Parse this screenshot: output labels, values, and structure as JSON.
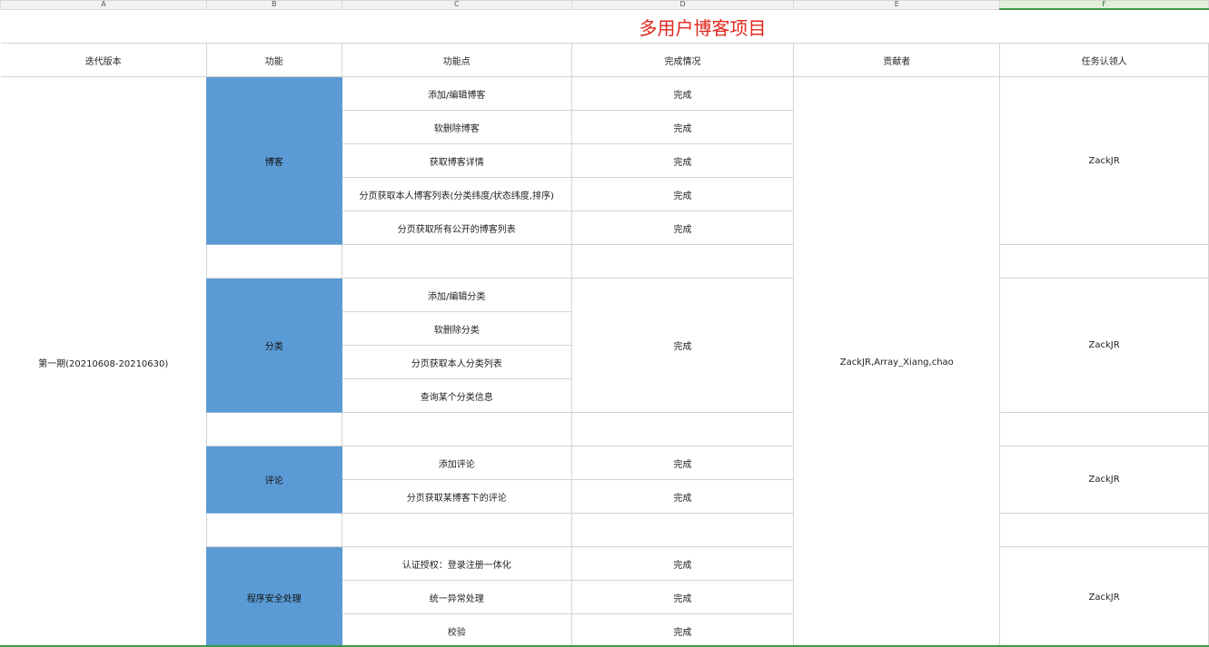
{
  "col_headers": [
    "A",
    "B",
    "C",
    "D",
    "E",
    "F"
  ],
  "title": "多用户博客项目",
  "headers": {
    "version": "迭代版本",
    "feature": "功能",
    "points": "功能点",
    "status": "完成情况",
    "contributors": "贡献者",
    "assignee": "任务认领人"
  },
  "version": "第一期(20210608-20210630)",
  "contributors": "ZackJR,Array_Xiang,chao",
  "groups": [
    {
      "feature": "博客",
      "assignee": "ZackJR",
      "points": [
        "添加/编辑博客",
        "软删除博客",
        "获取博客详情",
        "分页获取本人博客列表(分类纬度/状态纬度,排序)",
        "分页获取所有公开的博客列表"
      ],
      "status": [
        "完成",
        "完成",
        "完成",
        "完成",
        "完成"
      ]
    },
    {
      "feature": "分类",
      "assignee": "ZackJR",
      "points": [
        "添加/编辑分类",
        "软删除分类",
        "分页获取本人分类列表",
        "查询某个分类信息"
      ],
      "status": "完成"
    },
    {
      "feature": "评论",
      "assignee": "ZackJR",
      "points": [
        "添加评论",
        "分页获取某博客下的评论"
      ],
      "status": [
        "完成",
        "完成"
      ]
    },
    {
      "feature": "程序安全处理",
      "assignee": "ZackJR",
      "points": [
        "认证授权：登录注册一体化",
        "统一异常处理",
        "校验"
      ],
      "status": [
        "完成",
        "完成",
        "完成"
      ]
    }
  ]
}
